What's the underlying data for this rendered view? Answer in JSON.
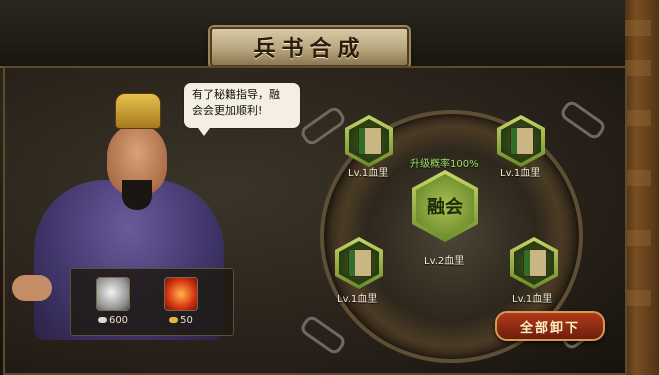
{
  "title": "兵书合成",
  "speech": {
    "line1": "有了秘籍指导，融",
    "line2": "会会更加顺利!"
  },
  "costs": [
    {
      "icon": "silver-icon",
      "value": "600"
    },
    {
      "icon": "fire-icon",
      "value": "50"
    }
  ],
  "wheel": {
    "success_rate": "升级概率100%",
    "fuse_label": "融会",
    "result_level": "Lv.2血里",
    "slots": [
      {
        "level": "Lv.1血里"
      },
      {
        "level": "Lv.1血里"
      },
      {
        "level": "Lv.1血里"
      },
      {
        "level": "Lv.1血里"
      }
    ]
  },
  "unload_all_label": "全部卸下"
}
